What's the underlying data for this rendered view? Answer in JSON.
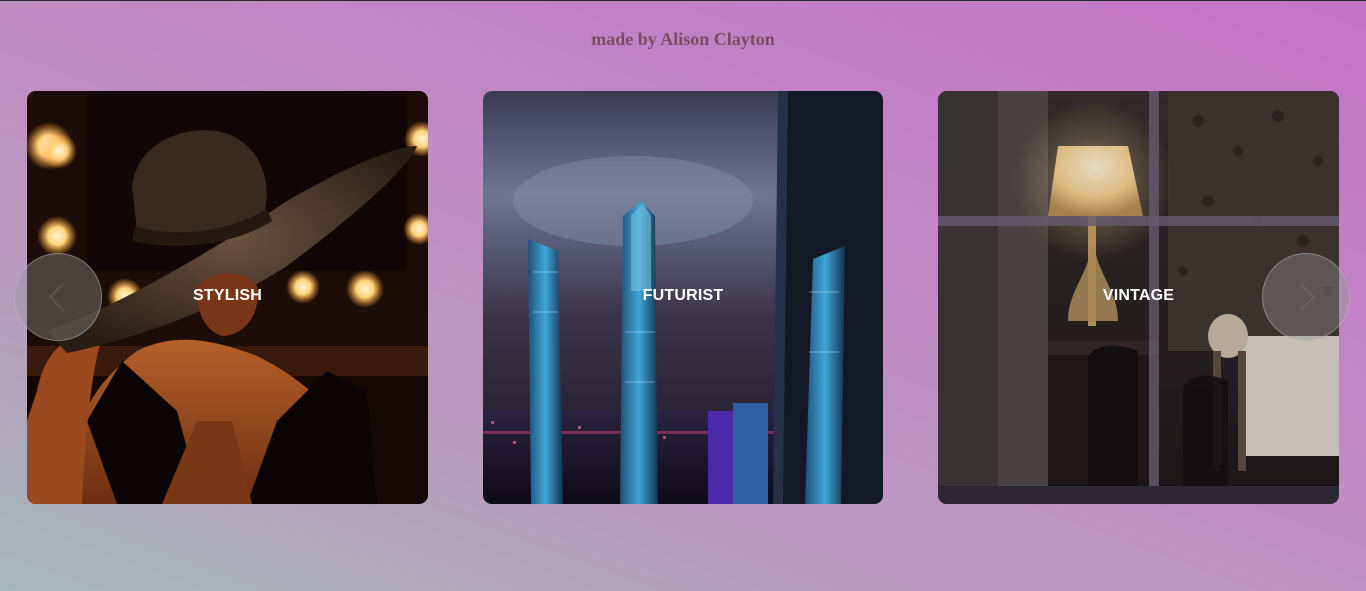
{
  "credit": {
    "text": "made by Alison Clayton",
    "color": "#7d4a66"
  },
  "carousel": {
    "slides": [
      {
        "label": "STYLISH",
        "image": "woman-in-straw-hat-vanity-mirror"
      },
      {
        "label": "FUTURIST",
        "image": "night-skyscrapers-city"
      },
      {
        "label": "VINTAGE",
        "image": "dining-room-through-window"
      }
    ],
    "prev_icon": "chevron-left-icon",
    "next_icon": "chevron-right-icon"
  },
  "colors": {
    "background_top": "#c274c6",
    "background_bottom": "#a6b8b9",
    "label": "#ffffff"
  }
}
